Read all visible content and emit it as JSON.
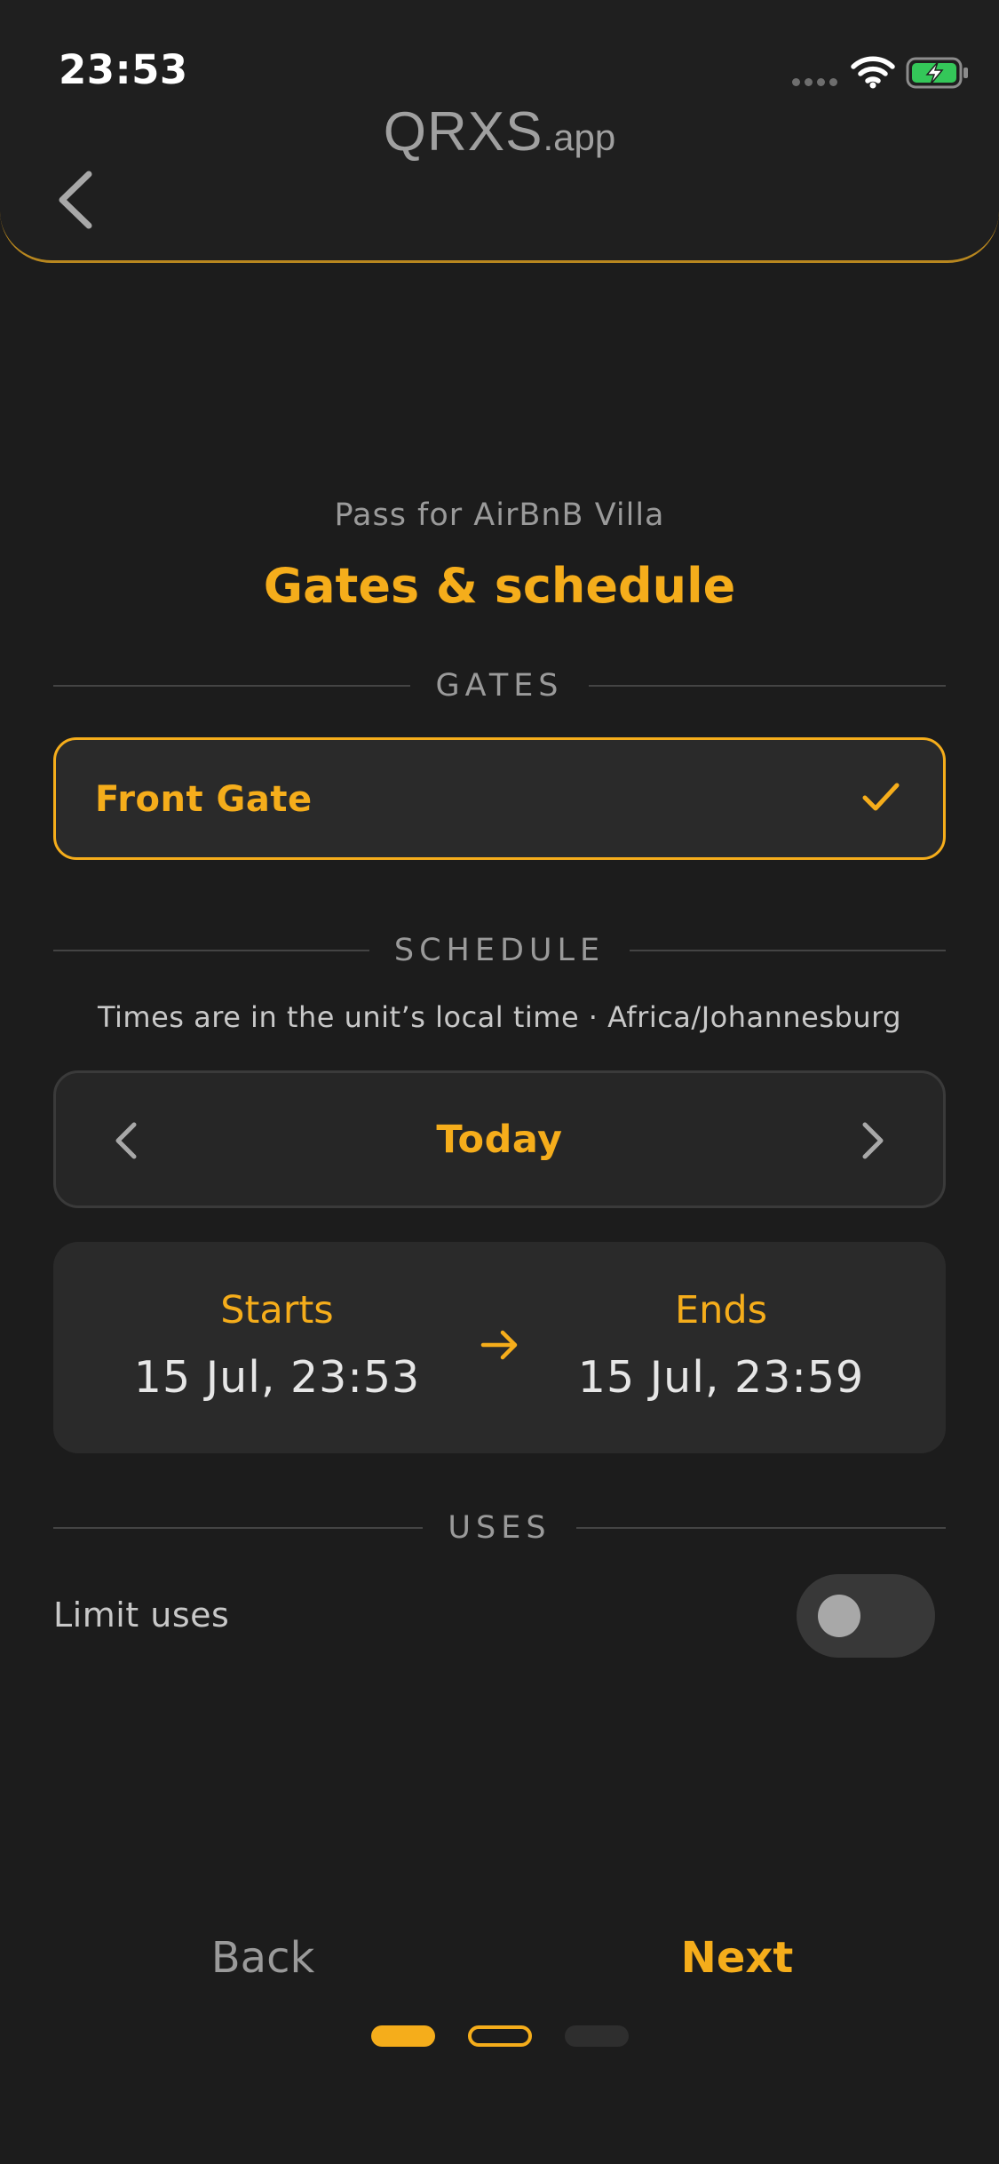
{
  "status_bar": {
    "time": "23:53"
  },
  "header": {
    "brand_main": "QRXS",
    "brand_suffix": ".app",
    "back_icon": "chevron-left-icon"
  },
  "intro": {
    "subtitle": "Pass for AirBnB Villa",
    "title": "Gates & schedule"
  },
  "gates": {
    "section_label": "GATES",
    "items": [
      {
        "name": "Front Gate",
        "selected": true,
        "icon": "check-icon"
      }
    ]
  },
  "schedule": {
    "section_label": "SCHEDULE",
    "timezone_note": "Times are in the unit’s local time · Africa/Johannesburg",
    "day_label": "Today",
    "starts_label": "Starts",
    "starts_value": "15 Jul, 23:53",
    "ends_label": "Ends",
    "ends_value": "15 Jul, 23:59"
  },
  "uses": {
    "section_label": "USES",
    "limit_label": "Limit uses",
    "limit_enabled": false
  },
  "footer": {
    "back_label": "Back",
    "next_label": "Next",
    "steps": [
      "done",
      "current",
      "todo"
    ]
  },
  "colors": {
    "accent": "#f5ad1b",
    "background": "#1c1c1c",
    "card": "#2a2a2a",
    "muted_text": "#9a9a9a",
    "battery_green": "#34c759"
  }
}
